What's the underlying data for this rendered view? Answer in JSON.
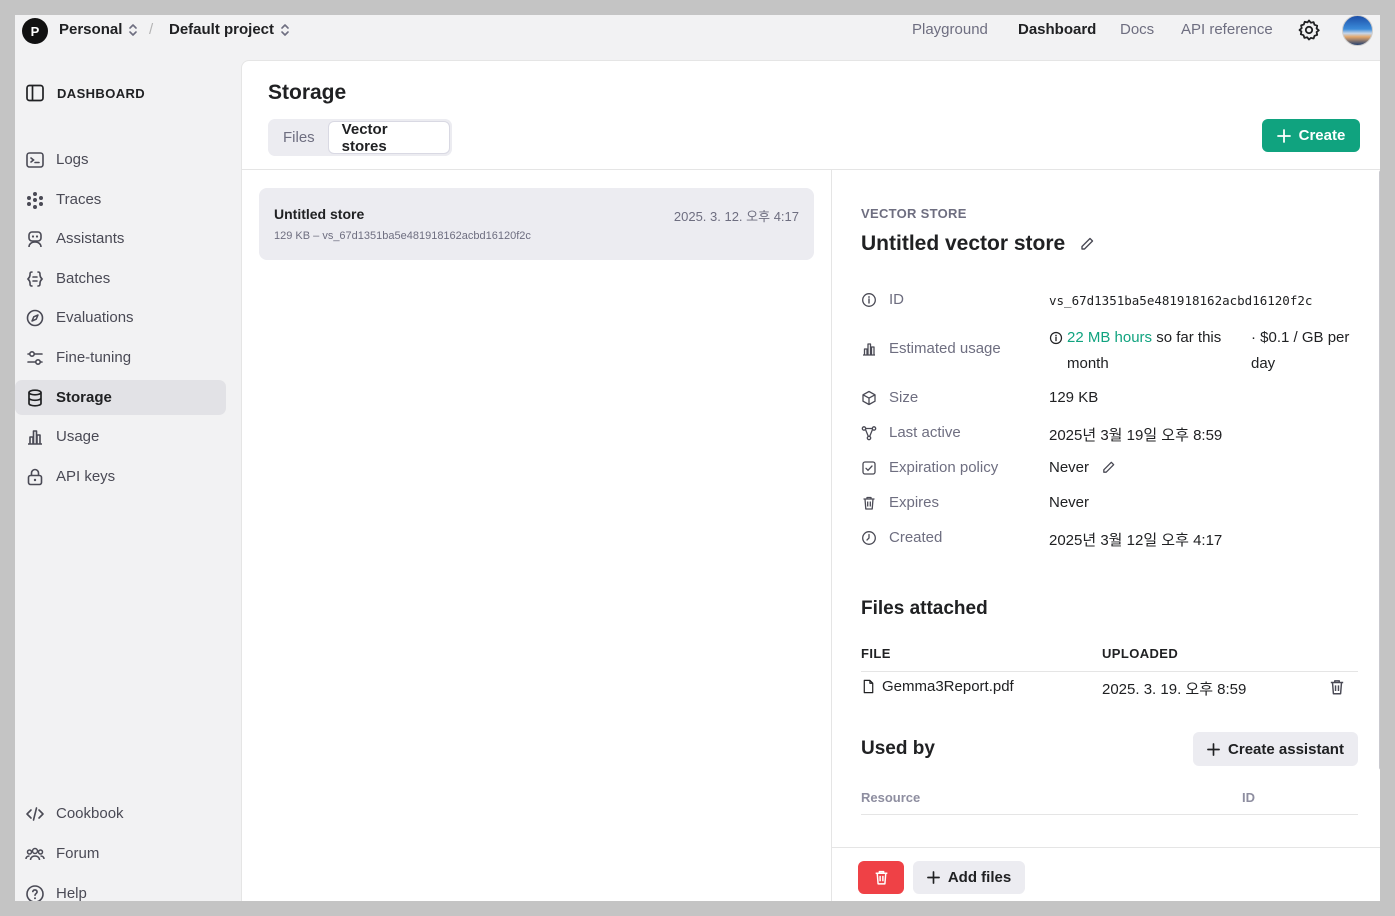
{
  "topbar": {
    "org_initial": "P",
    "org_name": "Personal",
    "separator": "/",
    "project_name": "Default project",
    "nav": [
      "Playground",
      "Dashboard",
      "Docs",
      "API reference"
    ]
  },
  "sidebar": {
    "header": "DASHBOARD",
    "items": [
      {
        "label": "Logs",
        "icon": "terminal-icon"
      },
      {
        "label": "Traces",
        "icon": "traces-icon"
      },
      {
        "label": "Assistants",
        "icon": "robot-icon"
      },
      {
        "label": "Batches",
        "icon": "braces-icon"
      },
      {
        "label": "Evaluations",
        "icon": "compass-icon"
      },
      {
        "label": "Fine-tuning",
        "icon": "sliders-icon"
      },
      {
        "label": "Storage",
        "icon": "database-icon",
        "active": true
      },
      {
        "label": "Usage",
        "icon": "bar-chart-icon"
      },
      {
        "label": "API keys",
        "icon": "lock-icon"
      }
    ],
    "bottom": [
      {
        "label": "Cookbook",
        "icon": "code-icon"
      },
      {
        "label": "Forum",
        "icon": "users-icon"
      },
      {
        "label": "Help",
        "icon": "help-icon"
      }
    ]
  },
  "main": {
    "title": "Storage",
    "tabs": [
      "Files",
      "Vector stores"
    ],
    "create_label": "Create",
    "store": {
      "name": "Untitled store",
      "date": "2025. 3. 12. 오후 4:17",
      "subtitle": "129 KB – vs_67d1351ba5e481918162acbd16120f2c"
    }
  },
  "detail": {
    "label": "VECTOR STORE",
    "title": "Untitled vector store",
    "rows": {
      "id_label": "ID",
      "id_value": "vs_67d1351ba5e481918162acbd16120f2c",
      "usage_label": "Estimated usage",
      "usage_highlight": "22 MB hours",
      "usage_rest": "so far this month",
      "usage_rate": "· $0.1 / GB per day",
      "size_label": "Size",
      "size_value": "129 KB",
      "active_label": "Last active",
      "active_value": "2025년 3월 19일 오후 8:59",
      "policy_label": "Expiration policy",
      "policy_value": "Never",
      "expires_label": "Expires",
      "expires_value": "Never",
      "created_label": "Created",
      "created_value": "2025년 3월 12일 오후 4:17"
    },
    "files_title": "Files attached",
    "files_cols": [
      "FILE",
      "UPLOADED"
    ],
    "file": {
      "name": "Gemma3Report.pdf",
      "uploaded": "2025. 3. 19. 오후 8:59"
    },
    "used_by_title": "Used by",
    "create_assistant_label": "Create assistant",
    "used_cols": [
      "Resource",
      "ID"
    ],
    "add_files_label": "Add files"
  },
  "colors": {
    "accent": "#10a37f",
    "danger": "#ef4146"
  }
}
